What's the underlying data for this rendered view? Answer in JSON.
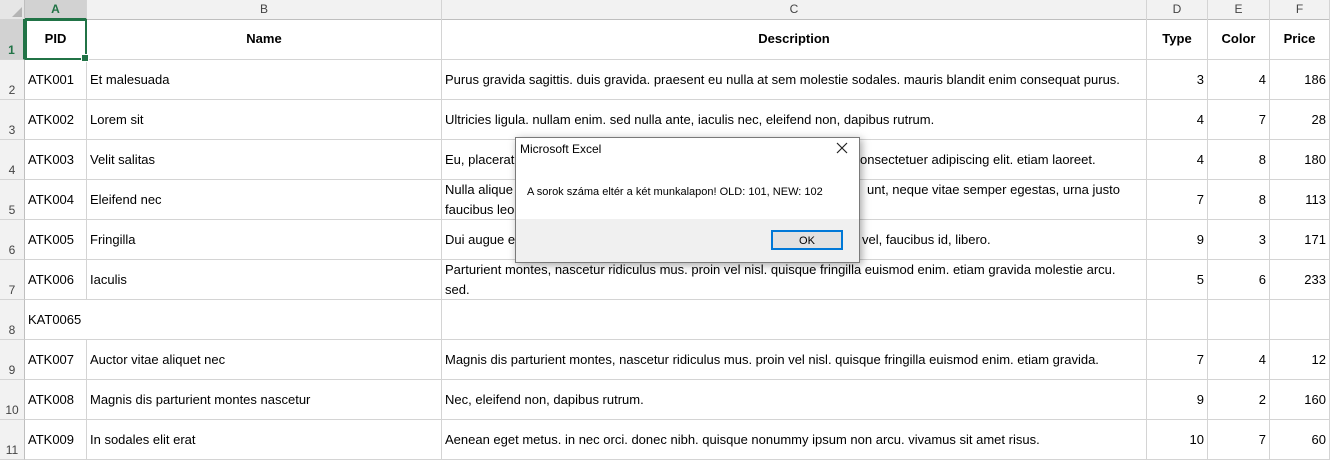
{
  "columns": [
    "A",
    "B",
    "C",
    "D",
    "E",
    "F"
  ],
  "row_numbers": [
    "1",
    "2",
    "3",
    "4",
    "5",
    "6",
    "7",
    "8",
    "9",
    "10",
    "11"
  ],
  "header": {
    "pid": "PID",
    "name": "Name",
    "description": "Description",
    "type": "Type",
    "color": "Color",
    "price": "Price"
  },
  "rows": [
    {
      "pid": "ATK001",
      "name": "Et malesuada",
      "description": "Purus gravida sagittis. duis gravida. praesent eu nulla at sem molestie sodales. mauris blandit enim consequat purus.",
      "type": "3",
      "color": "4",
      "price": "186"
    },
    {
      "pid": "ATK002",
      "name": "Lorem sit",
      "description": "Ultricies ligula. nullam enim. sed nulla ante, iaculis nec, eleifend non, dapibus rutrum.",
      "type": "4",
      "color": "7",
      "price": "28"
    },
    {
      "pid": "ATK003",
      "name": "Velit salitas",
      "description": "Eu, placerat",
      "description_tail": "onsectetuer adipiscing elit. etiam laoreet.",
      "type": "4",
      "color": "8",
      "price": "180"
    },
    {
      "pid": "ATK004",
      "name": "Eleifend nec",
      "description": "Nulla alique",
      "description_tail": "unt, neque vitae semper egestas, urna justo",
      "description_line2": "faucibus leo",
      "type": "7",
      "color": "8",
      "price": "113"
    },
    {
      "pid": "ATK005",
      "name": "Fringilla",
      "description": "Dui augue e",
      "description_tail": "vel, faucibus id, libero.",
      "type": "9",
      "color": "3",
      "price": "171"
    },
    {
      "pid": "ATK006",
      "name": "Iaculis",
      "description": "Parturient montes, nascetur ridiculus mus. proin vel nisl. quisque fringilla euismod enim. etiam gravida molestie arcu. sed.",
      "type": "5",
      "color": "6",
      "price": "233"
    },
    {
      "pid": "KAT0065",
      "name": "",
      "description": "",
      "type": "",
      "color": "",
      "price": ""
    },
    {
      "pid": "ATK007",
      "name": "Auctor vitae aliquet nec",
      "description": "Magnis dis parturient montes, nascetur ridiculus mus. proin vel nisl. quisque fringilla euismod enim. etiam gravida.",
      "type": "7",
      "color": "4",
      "price": "12"
    },
    {
      "pid": "ATK008",
      "name": "Magnis dis parturient montes nascetur",
      "description": "Nec, eleifend non, dapibus rutrum.",
      "type": "9",
      "color": "2",
      "price": "160"
    },
    {
      "pid": "ATK009",
      "name": "In sodales elit erat",
      "description": "Aenean eget metus. in nec orci. donec nibh. quisque nonummy ipsum non arcu. vivamus sit amet risus.",
      "type": "10",
      "color": "7",
      "price": "60"
    }
  ],
  "dialog": {
    "title": "Microsoft Excel",
    "message": "A sorok száma eltér a két munkalapon! OLD: 101, NEW: 102",
    "ok_label": "OK"
  },
  "colors": {
    "excel_green": "#217346",
    "dialog_focus": "#0078d7"
  }
}
